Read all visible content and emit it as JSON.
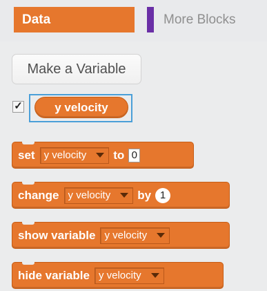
{
  "categories": {
    "active": "Data",
    "other": "More Blocks"
  },
  "palette": {
    "make_variable_label": "Make a Variable",
    "variable_checkbox": "✓",
    "variable_reporter": "y velocity"
  },
  "blocks": {
    "set": {
      "keyword": "set",
      "variable": "y velocity",
      "keyword2": "to",
      "value": "0"
    },
    "change": {
      "keyword": "change",
      "variable": "y velocity",
      "keyword2": "by",
      "value": "1"
    },
    "show": {
      "keyword": "show variable",
      "variable": "y velocity"
    },
    "hide": {
      "keyword": "hide variable",
      "variable": "y velocity"
    }
  },
  "colors": {
    "data_orange": "#e6772d",
    "more_blocks_purple": "#6a2fa6",
    "selection_blue": "#4a9fd8"
  }
}
